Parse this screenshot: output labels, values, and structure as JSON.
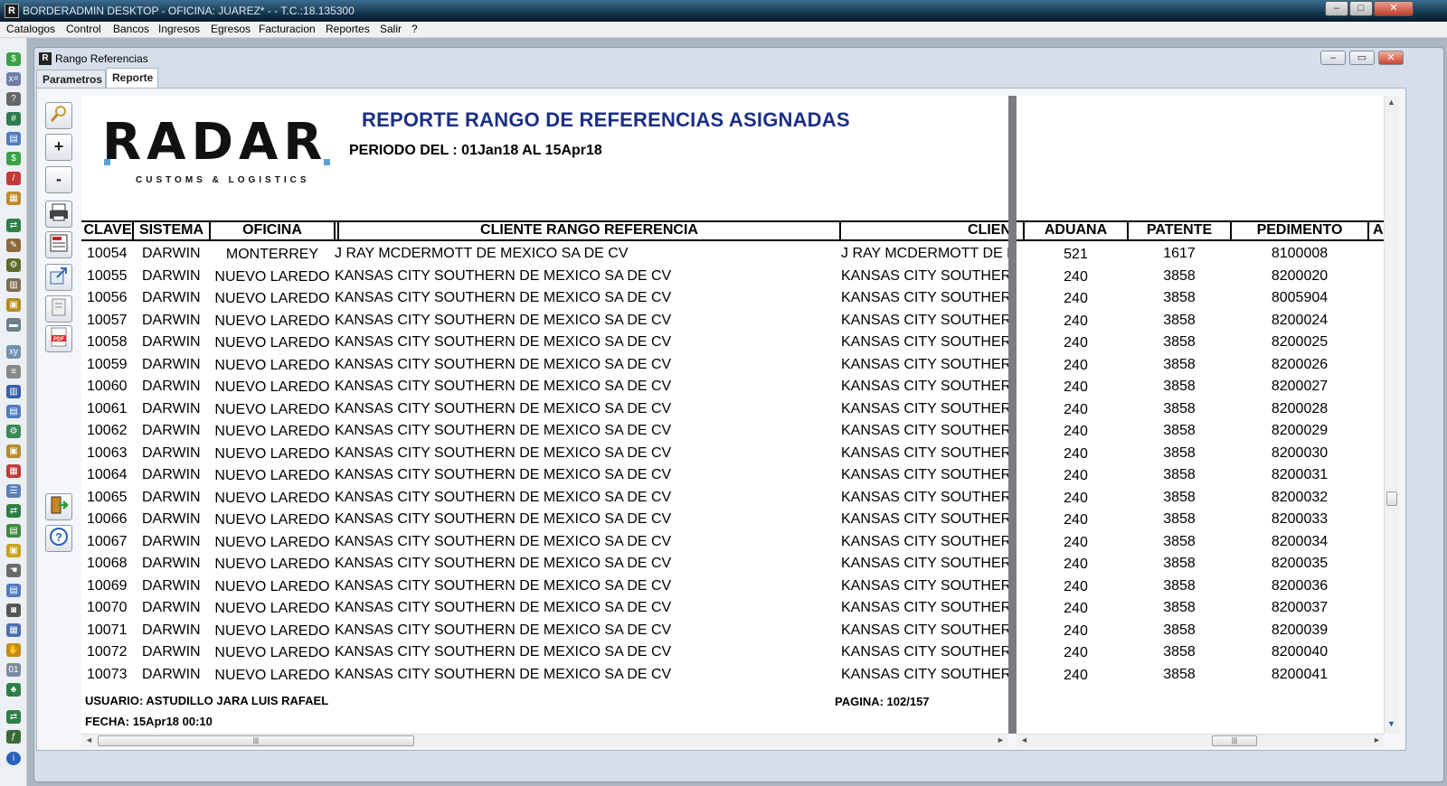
{
  "titlebar": {
    "title": "BORDERADMIN DESKTOP - OFICINA: JUAREZ* -   - T.C.:18.135300",
    "logo": "R",
    "minimize": "–",
    "maximize": "□",
    "close": "✕"
  },
  "menubar": {
    "items": [
      "Catalogos",
      "Control",
      "Bancos",
      "Ingresos",
      "Egresos",
      "Facturacion",
      "Reportes",
      "Salir",
      "?"
    ]
  },
  "child_window": {
    "title": "Rango Referencias",
    "logo": "R",
    "minimize": "–",
    "maximize": "▭",
    "close": "✕"
  },
  "tabs": [
    "Parametros",
    "Reporte"
  ],
  "viewer_tools": {
    "zoom_in": "+",
    "zoom_out": "-"
  },
  "report": {
    "title": "REPORTE RANGO DE REFERENCIAS ASIGNADAS",
    "period": "PERIODO DEL : 01Jan18 AL 15Apr18",
    "logo_main": "RADAR",
    "logo_sub": "CUSTOMS & LOGISTICS",
    "headers_left": [
      "CLAVE",
      "SISTEMA",
      "OFICINA",
      "CLIENTE RANGO REFERENCIA",
      "CLIEN"
    ],
    "headers_right": [
      "ADUANA",
      "PATENTE",
      "PEDIMENTO",
      "A"
    ],
    "rows": [
      {
        "clave": "10054",
        "sistema": "DARWIN",
        "oficina": "MONTERREY",
        "cliente": "J RAY MCDERMOTT DE MEXICO SA DE CV",
        "cliente2": "J RAY MCDERMOTT DE MI",
        "aduana": "521",
        "patente": "1617",
        "pedimento": "8100008"
      },
      {
        "clave": "10055",
        "sistema": "DARWIN",
        "oficina": "NUEVO LAREDO",
        "cliente": "KANSAS CITY SOUTHERN DE MEXICO SA DE CV",
        "cliente2": "KANSAS CITY SOUTHERN",
        "aduana": "240",
        "patente": "3858",
        "pedimento": "8200020"
      },
      {
        "clave": "10056",
        "sistema": "DARWIN",
        "oficina": "NUEVO LAREDO",
        "cliente": "KANSAS CITY SOUTHERN DE MEXICO SA DE CV",
        "cliente2": "KANSAS CITY SOUTHERN",
        "aduana": "240",
        "patente": "3858",
        "pedimento": "8005904"
      },
      {
        "clave": "10057",
        "sistema": "DARWIN",
        "oficina": "NUEVO LAREDO",
        "cliente": "KANSAS CITY SOUTHERN DE MEXICO SA DE CV",
        "cliente2": "KANSAS CITY SOUTHERN",
        "aduana": "240",
        "patente": "3858",
        "pedimento": "8200024"
      },
      {
        "clave": "10058",
        "sistema": "DARWIN",
        "oficina": "NUEVO LAREDO",
        "cliente": "KANSAS CITY SOUTHERN DE MEXICO SA DE CV",
        "cliente2": "KANSAS CITY SOUTHERN",
        "aduana": "240",
        "patente": "3858",
        "pedimento": "8200025"
      },
      {
        "clave": "10059",
        "sistema": "DARWIN",
        "oficina": "NUEVO LAREDO",
        "cliente": "KANSAS CITY SOUTHERN DE MEXICO SA DE CV",
        "cliente2": "KANSAS CITY SOUTHERN",
        "aduana": "240",
        "patente": "3858",
        "pedimento": "8200026"
      },
      {
        "clave": "10060",
        "sistema": "DARWIN",
        "oficina": "NUEVO LAREDO",
        "cliente": "KANSAS CITY SOUTHERN DE MEXICO SA DE CV",
        "cliente2": "KANSAS CITY SOUTHERN",
        "aduana": "240",
        "patente": "3858",
        "pedimento": "8200027"
      },
      {
        "clave": "10061",
        "sistema": "DARWIN",
        "oficina": "NUEVO LAREDO",
        "cliente": "KANSAS CITY SOUTHERN DE MEXICO SA DE CV",
        "cliente2": "KANSAS CITY SOUTHERN",
        "aduana": "240",
        "patente": "3858",
        "pedimento": "8200028"
      },
      {
        "clave": "10062",
        "sistema": "DARWIN",
        "oficina": "NUEVO LAREDO",
        "cliente": "KANSAS CITY SOUTHERN DE MEXICO SA DE CV",
        "cliente2": "KANSAS CITY SOUTHERN",
        "aduana": "240",
        "patente": "3858",
        "pedimento": "8200029"
      },
      {
        "clave": "10063",
        "sistema": "DARWIN",
        "oficina": "NUEVO LAREDO",
        "cliente": "KANSAS CITY SOUTHERN DE MEXICO SA DE CV",
        "cliente2": "KANSAS CITY SOUTHERN",
        "aduana": "240",
        "patente": "3858",
        "pedimento": "8200030"
      },
      {
        "clave": "10064",
        "sistema": "DARWIN",
        "oficina": "NUEVO LAREDO",
        "cliente": "KANSAS CITY SOUTHERN DE MEXICO SA DE CV",
        "cliente2": "KANSAS CITY SOUTHERN",
        "aduana": "240",
        "patente": "3858",
        "pedimento": "8200031"
      },
      {
        "clave": "10065",
        "sistema": "DARWIN",
        "oficina": "NUEVO LAREDO",
        "cliente": "KANSAS CITY SOUTHERN DE MEXICO SA DE CV",
        "cliente2": "KANSAS CITY SOUTHERN",
        "aduana": "240",
        "patente": "3858",
        "pedimento": "8200032"
      },
      {
        "clave": "10066",
        "sistema": "DARWIN",
        "oficina": "NUEVO LAREDO",
        "cliente": "KANSAS CITY SOUTHERN DE MEXICO SA DE CV",
        "cliente2": "KANSAS CITY SOUTHERN",
        "aduana": "240",
        "patente": "3858",
        "pedimento": "8200033"
      },
      {
        "clave": "10067",
        "sistema": "DARWIN",
        "oficina": "NUEVO LAREDO",
        "cliente": "KANSAS CITY SOUTHERN DE MEXICO SA DE CV",
        "cliente2": "KANSAS CITY SOUTHERN",
        "aduana": "240",
        "patente": "3858",
        "pedimento": "8200034"
      },
      {
        "clave": "10068",
        "sistema": "DARWIN",
        "oficina": "NUEVO LAREDO",
        "cliente": "KANSAS CITY SOUTHERN DE MEXICO SA DE CV",
        "cliente2": "KANSAS CITY SOUTHERN",
        "aduana": "240",
        "patente": "3858",
        "pedimento": "8200035"
      },
      {
        "clave": "10069",
        "sistema": "DARWIN",
        "oficina": "NUEVO LAREDO",
        "cliente": "KANSAS CITY SOUTHERN DE MEXICO SA DE CV",
        "cliente2": "KANSAS CITY SOUTHERN",
        "aduana": "240",
        "patente": "3858",
        "pedimento": "8200036"
      },
      {
        "clave": "10070",
        "sistema": "DARWIN",
        "oficina": "NUEVO LAREDO",
        "cliente": "KANSAS CITY SOUTHERN DE MEXICO SA DE CV",
        "cliente2": "KANSAS CITY SOUTHERN",
        "aduana": "240",
        "patente": "3858",
        "pedimento": "8200037"
      },
      {
        "clave": "10071",
        "sistema": "DARWIN",
        "oficina": "NUEVO LAREDO",
        "cliente": "KANSAS CITY SOUTHERN DE MEXICO SA DE CV",
        "cliente2": "KANSAS CITY SOUTHERN",
        "aduana": "240",
        "patente": "3858",
        "pedimento": "8200039"
      },
      {
        "clave": "10072",
        "sistema": "DARWIN",
        "oficina": "NUEVO LAREDO",
        "cliente": "KANSAS CITY SOUTHERN DE MEXICO SA DE CV",
        "cliente2": "KANSAS CITY SOUTHERN",
        "aduana": "240",
        "patente": "3858",
        "pedimento": "8200040"
      },
      {
        "clave": "10073",
        "sistema": "DARWIN",
        "oficina": "NUEVO LAREDO",
        "cliente": "KANSAS CITY SOUTHERN DE MEXICO SA DE CV",
        "cliente2": "KANSAS CITY SOUTHERN",
        "aduana": "240",
        "patente": "3858",
        "pedimento": "8200041"
      }
    ],
    "footer": {
      "usuario": "USUARIO: ASTUDILLO JARA LUIS RAFAEL",
      "fecha": "FECHA: 15Apr18 00:10",
      "pagina": "PAGINA: 102/157"
    }
  },
  "colors": {
    "title_blue": "#1c2f85",
    "logo_accent": "#5aa3d8",
    "divider": "#7a7c80"
  }
}
